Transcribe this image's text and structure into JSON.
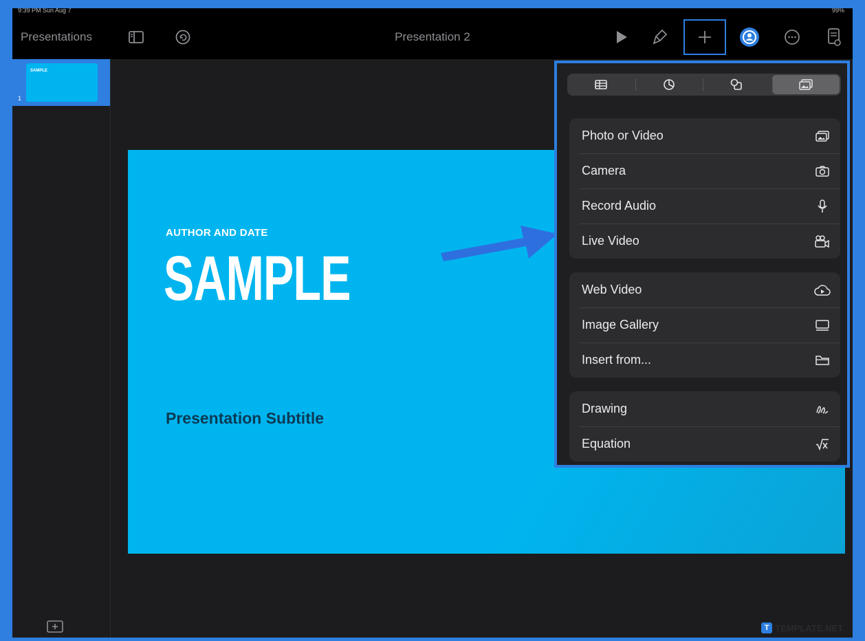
{
  "status_bar": {
    "left": "9:39 PM  Sun Aug 7",
    "right": "99%"
  },
  "toolbar": {
    "back_label": "Presentations",
    "document_title": "Presentation 2",
    "icons": [
      "sidebar-icon",
      "undo-icon",
      "play-icon",
      "paintbrush-icon",
      "plus-icon",
      "collaborate-icon",
      "more-icon",
      "document-options-icon"
    ]
  },
  "slide_navigator": {
    "thumbnail_label": "SAMPLE",
    "slide_number": "1"
  },
  "slide": {
    "author": "AUTHOR AND DATE",
    "title": "SAMPLE",
    "subtitle": "Presentation Subtitle",
    "background_color": "#00b5ef"
  },
  "insert_popover": {
    "tabs": [
      {
        "icon": "table-icon"
      },
      {
        "icon": "chart-icon"
      },
      {
        "icon": "shapes-icon"
      },
      {
        "icon": "media-icon",
        "selected": true
      }
    ],
    "groups": [
      [
        {
          "label": "Photo or Video",
          "icon": "photo-icon"
        },
        {
          "label": "Camera",
          "icon": "camera-icon"
        },
        {
          "label": "Record Audio",
          "icon": "microphone-icon"
        },
        {
          "label": "Live Video",
          "icon": "live-video-icon"
        }
      ],
      [
        {
          "label": "Web Video",
          "icon": "web-video-icon"
        },
        {
          "label": "Image Gallery",
          "icon": "image-gallery-icon"
        },
        {
          "label": "Insert from...",
          "icon": "folder-icon"
        }
      ],
      [
        {
          "label": "Drawing",
          "icon": "drawing-icon"
        },
        {
          "label": "Equation",
          "icon": "equation-icon"
        }
      ]
    ]
  },
  "watermark": {
    "letter": "T",
    "text": "TEMPLATE.NET"
  },
  "colors": {
    "highlight": "#2e7fe0",
    "toolbar_bg": "#000000",
    "popover_row": "#2c2c2e"
  }
}
